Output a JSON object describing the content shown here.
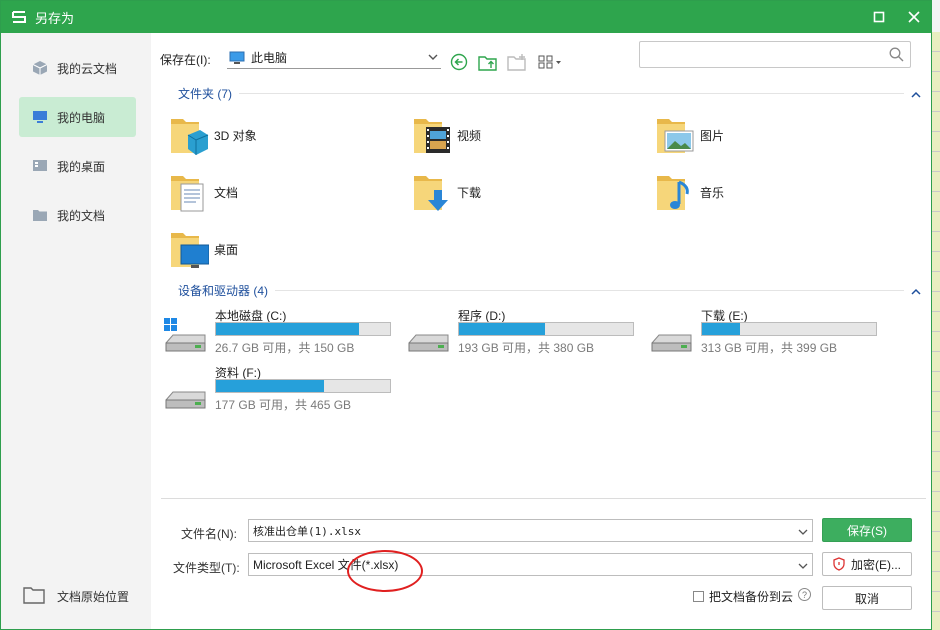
{
  "window": {
    "title": "另存为"
  },
  "sidebar": {
    "items": [
      {
        "label": "我的云文档",
        "icon": "cloud-cube-icon",
        "active": false
      },
      {
        "label": "我的电脑",
        "icon": "monitor-icon",
        "active": true
      },
      {
        "label": "我的桌面",
        "icon": "desktop-icon",
        "active": false
      },
      {
        "label": "我的文档",
        "icon": "folder-icon",
        "active": false
      }
    ],
    "bottom_label": "文档原始位置"
  },
  "toolbar": {
    "save_in_label": "保存在(I):",
    "location": "此电脑",
    "search_placeholder": ""
  },
  "folders_group": {
    "header": "文件夹 (7)",
    "items": [
      {
        "label": "3D 对象",
        "icon": "3d-objects-folder-icon"
      },
      {
        "label": "视频",
        "icon": "videos-folder-icon"
      },
      {
        "label": "图片",
        "icon": "pictures-folder-icon"
      },
      {
        "label": "文档",
        "icon": "documents-folder-icon"
      },
      {
        "label": "下载",
        "icon": "downloads-folder-icon"
      },
      {
        "label": "音乐",
        "icon": "music-folder-icon"
      },
      {
        "label": "桌面",
        "icon": "desktop-folder-icon"
      }
    ]
  },
  "drives_group": {
    "header": "设备和驱动器 (4)",
    "items": [
      {
        "name": "本地磁盘 (C:)",
        "free": "26.7 GB 可用，共 150 GB",
        "used_fraction": 0.822,
        "icon": "windows-drive-icon"
      },
      {
        "name": "程序 (D:)",
        "free": "193 GB 可用，共 380 GB",
        "used_fraction": 0.492,
        "icon": "hard-drive-icon"
      },
      {
        "name": "下载 (E:)",
        "free": "313 GB 可用，共 399 GB",
        "used_fraction": 0.216,
        "icon": "hard-drive-icon"
      },
      {
        "name": "资料 (F:)",
        "free": "177 GB 可用，共 465 GB",
        "used_fraction": 0.619,
        "icon": "hard-drive-icon"
      }
    ]
  },
  "form": {
    "filename_label": "文件名(N):",
    "filename_value": "核准出仓单(1).xlsx",
    "filetype_label": "文件类型(T):",
    "filetype_value": "Microsoft Excel 文件(*.xlsx)",
    "backup_label": "把文档备份到云",
    "help_symbol": "?"
  },
  "buttons": {
    "save": "保存(S)",
    "encrypt": "加密(E)...",
    "cancel": "取消"
  },
  "colors": {
    "titlebar": "#2ea54d",
    "accent": "#3dae5f",
    "drive_bar": "#26a0da",
    "annotation": "#e02020"
  }
}
